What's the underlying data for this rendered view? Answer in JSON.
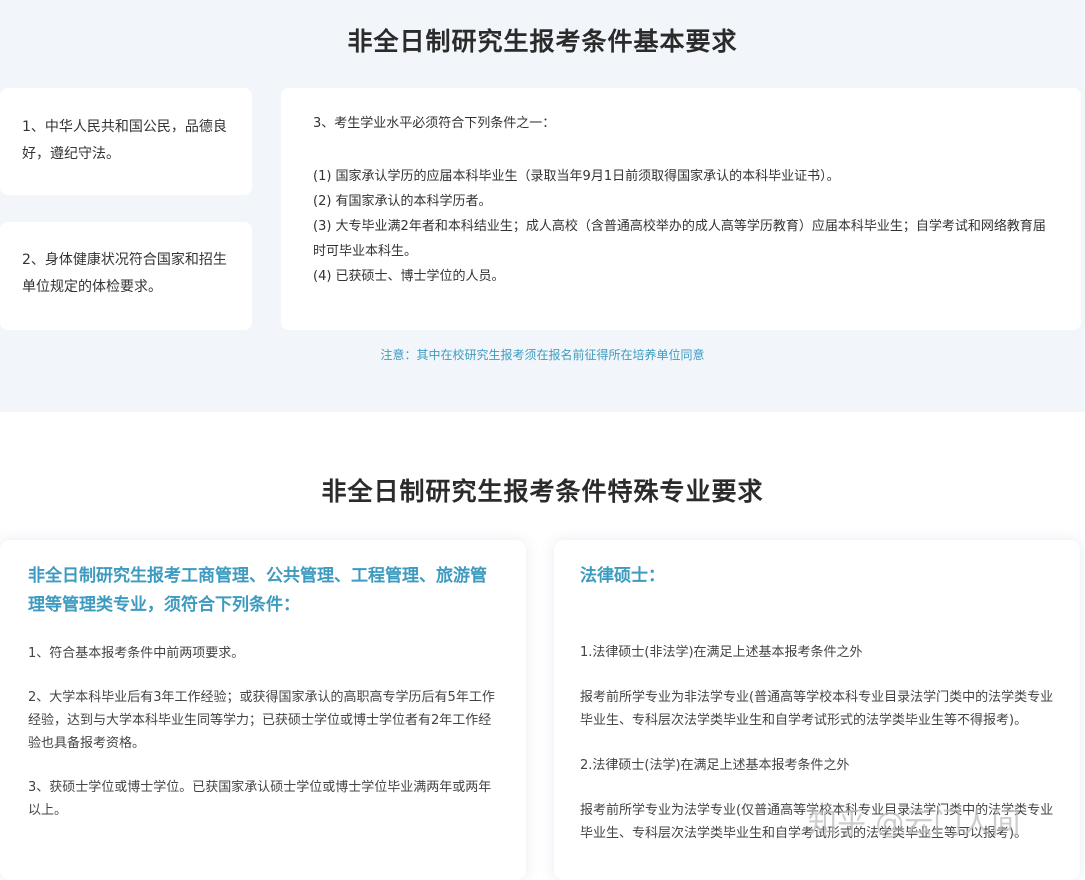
{
  "basic": {
    "title": "非全日制研究生报考条件基本要求",
    "card1": "1、中华人民共和国公民，品德良好，遵纪守法。",
    "card2": "2、身体健康状况符合国家和招生单位规定的体检要求。",
    "card3": {
      "lead": "3、考生学业水平必须符合下列条件之一：",
      "conditions": [
        "(1) 国家承认学历的应届本科毕业生（录取当年9月1日前须取得国家承认的本科毕业证书）。",
        "(2) 有国家承认的本科学历者。",
        "(3) 大专毕业满2年者和本科结业生；成人高校（含普通高校举办的成人高等学历教育）应届本科毕业生；自学考试和网络教育届时可毕业本科生。",
        "(4) 已获硕士、博士学位的人员。"
      ]
    },
    "note": "注意：其中在校研究生报考须在报名前征得所在培养单位同意"
  },
  "special": {
    "title": "非全日制研究生报考条件特殊专业要求",
    "management": {
      "title": "非全日制研究生报考工商管理、公共管理、工程管理、旅游管理等管理类专业，须符合下列条件：",
      "items": [
        "1、符合基本报考条件中前两项要求。",
        "2、大学本科毕业后有3年工作经验；或获得国家承认的高职高专学历后有5年工作经验，达到与大学本科毕业生同等学力；已获硕士学位或博士学位者有2年工作经验也具备报考资格。",
        "3、获硕士学位或博士学位。已获国家承认硕士学位或博士学位毕业满两年或两年以上。"
      ]
    },
    "law": {
      "title": "法律硕士：",
      "items": [
        "1.法律硕士(非法学)在满足上述基本报考条件之外",
        "报考前所学专业为非法学专业(普通高等学校本科专业目录法学门类中的法学类专业毕业生、专科层次法学类毕业生和自学考试形式的法学类毕业生等不得报考)。",
        "2.法律硕士(法学)在满足上述基本报考条件之外",
        "报考前所学专业为法学专业(仅普通高等学校本科专业目录法学门类中的法学类专业毕业生、专科层次法学类毕业生和自学考试形式的法学类毕业生等可以报考)。"
      ]
    }
  },
  "watermark": "知乎 @云门人间",
  "colors": {
    "accent": "#3d9bbf",
    "band_bg": "#f2f6fb"
  }
}
